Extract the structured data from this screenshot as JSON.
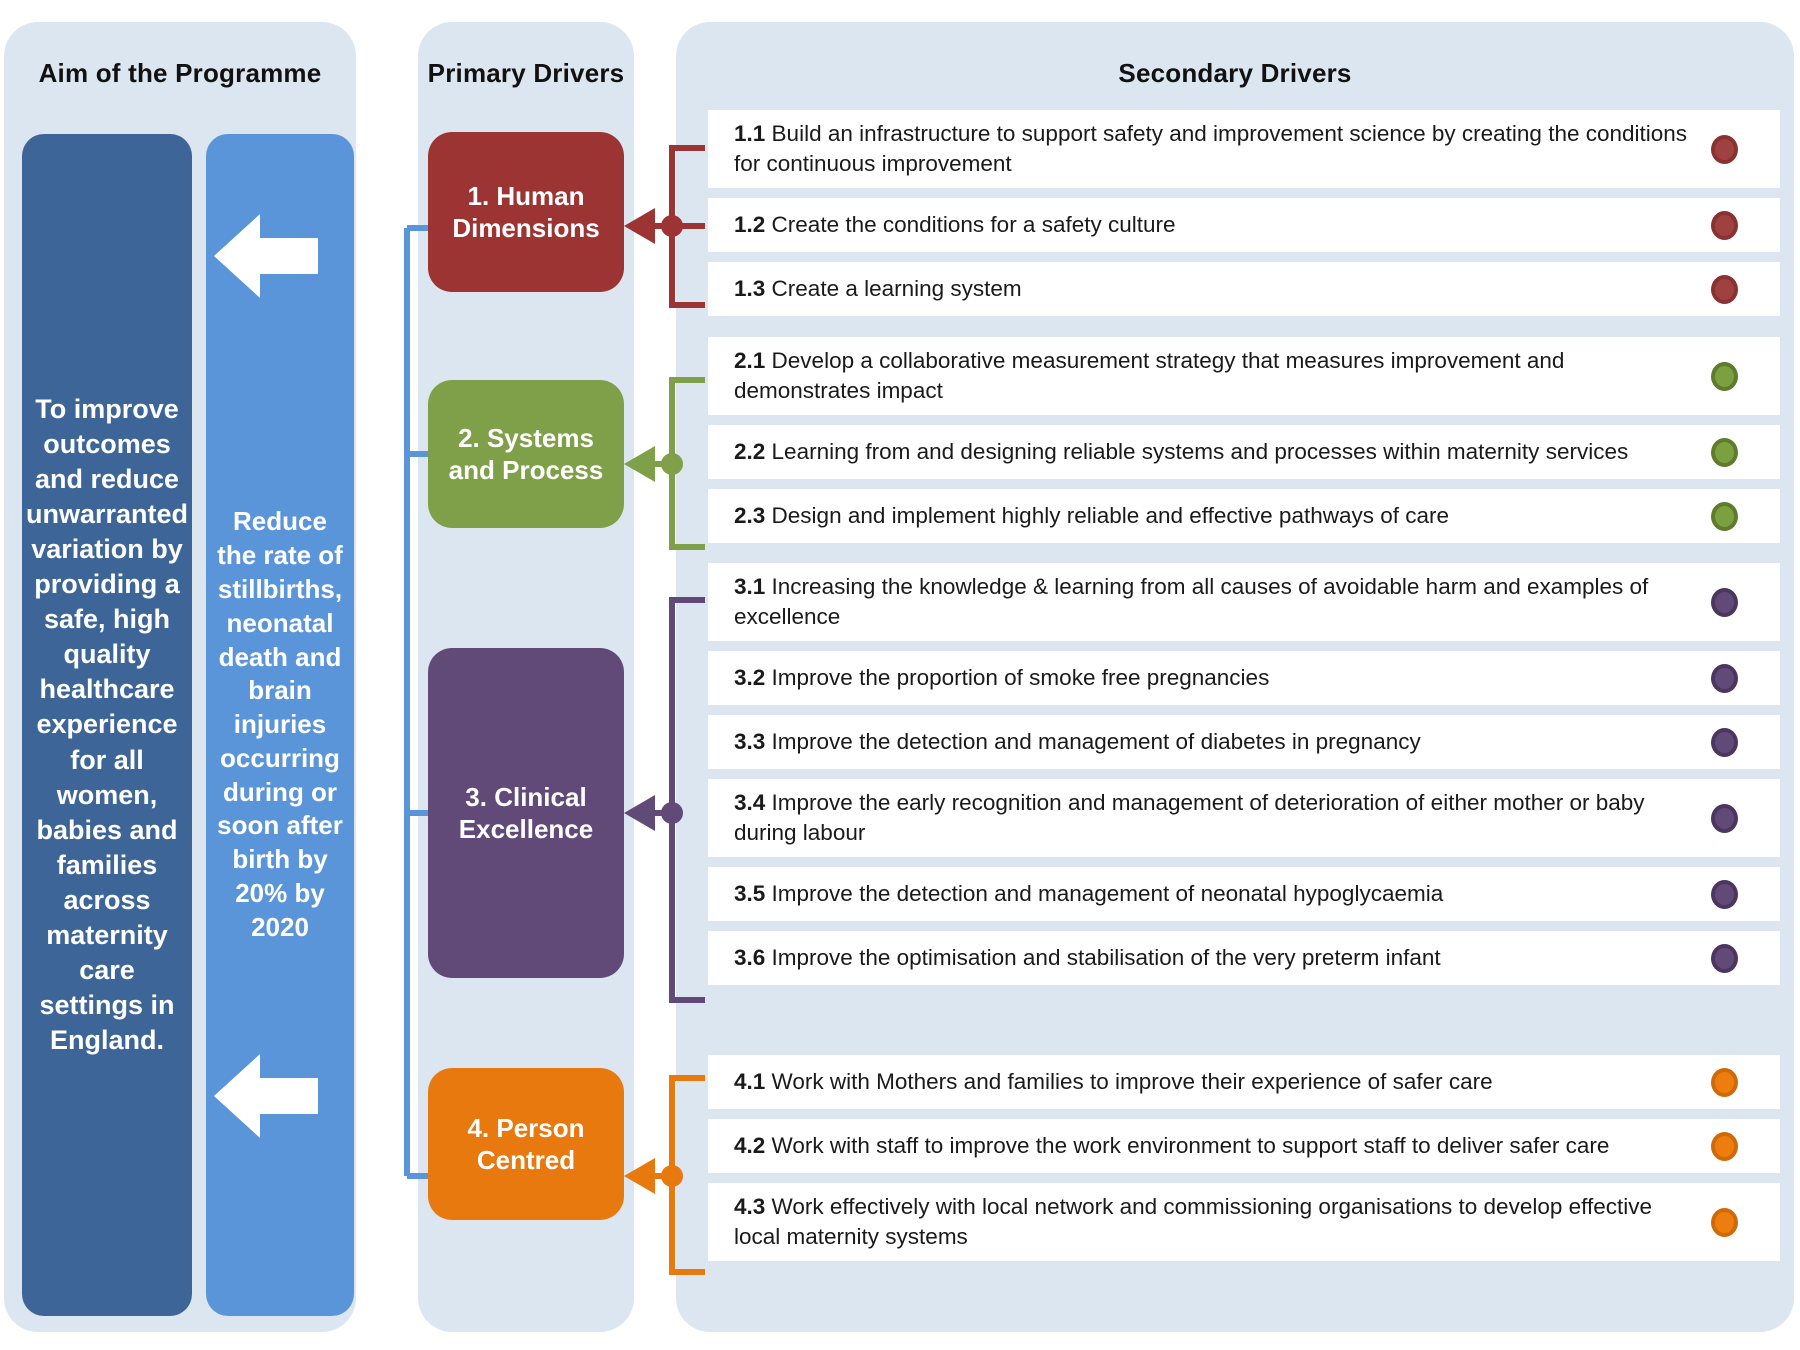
{
  "columns": {
    "aim_title": "Aim of the Programme",
    "primary_title": "Primary Drivers",
    "secondary_title": "Secondary Drivers"
  },
  "aim": {
    "primary_statement": "To improve outcomes and reduce unwarranted variation by providing a safe, high quality healthcare experience for all women, babies and families across maternity care settings in England.",
    "secondary_statement": "Reduce the rate of stillbirths, neonatal death and brain injuries occurring during or soon after birth by 20% by 2020"
  },
  "primary_drivers": [
    {
      "label": "1. Human Dimensions",
      "color": "#9c3434"
    },
    {
      "label": "2. Systems and Process",
      "color": "#7fa049"
    },
    {
      "label": "3. Clinical Excellence",
      "color": "#614a78"
    },
    {
      "label": "4. Person Centred",
      "color": "#e8790f"
    }
  ],
  "secondary_drivers": [
    {
      "group": 1,
      "color": "#9c3434",
      "items": [
        {
          "num": "1.1",
          "text": "Build an infrastructure to support safety and improvement science by creating the conditions for continuous improvement"
        },
        {
          "num": "1.2",
          "text": "Create the conditions for a safety culture"
        },
        {
          "num": "1.3",
          "text": "Create a learning system"
        }
      ]
    },
    {
      "group": 2,
      "color": "#7fa049",
      "items": [
        {
          "num": "2.1",
          "text": "Develop a collaborative measurement strategy that measures improvement and demonstrates impact"
        },
        {
          "num": "2.2",
          "text": "Learning from and designing reliable systems and processes within maternity services"
        },
        {
          "num": "2.3",
          "text": "Design and implement highly reliable and effective pathways of care"
        }
      ]
    },
    {
      "group": 3,
      "color": "#614a78",
      "items": [
        {
          "num": "3.1",
          "text": "Increasing the knowledge & learning from all causes of avoidable harm and examples of excellence"
        },
        {
          "num": "3.2",
          "text": "Improve the proportion of smoke free pregnancies"
        },
        {
          "num": "3.3",
          "text": "Improve the detection and management of diabetes in pregnancy"
        },
        {
          "num": "3.4",
          "text": "Improve the early recognition and management of deterioration of either mother or baby during labour"
        },
        {
          "num": "3.5",
          "text": "Improve the detection and management of neonatal hypoglycaemia"
        },
        {
          "num": "3.6",
          "text": "Improve the optimisation and stabilisation of the very preterm infant"
        }
      ]
    },
    {
      "group": 4,
      "color": "#e8790f",
      "items": [
        {
          "num": "4.1",
          "text": "Work with Mothers and families to improve their experience of safer care"
        },
        {
          "num": "4.2",
          "text": "Work with staff to improve the work environment to support staff to deliver safer care"
        },
        {
          "num": "4.3",
          "text": "Work effectively with local network and commissioning organisations to develop effective local maternity systems"
        }
      ]
    }
  ],
  "icons": {
    "aim_arrow": "left-arrow-icon",
    "dot": "driver-status-dot-icon"
  }
}
